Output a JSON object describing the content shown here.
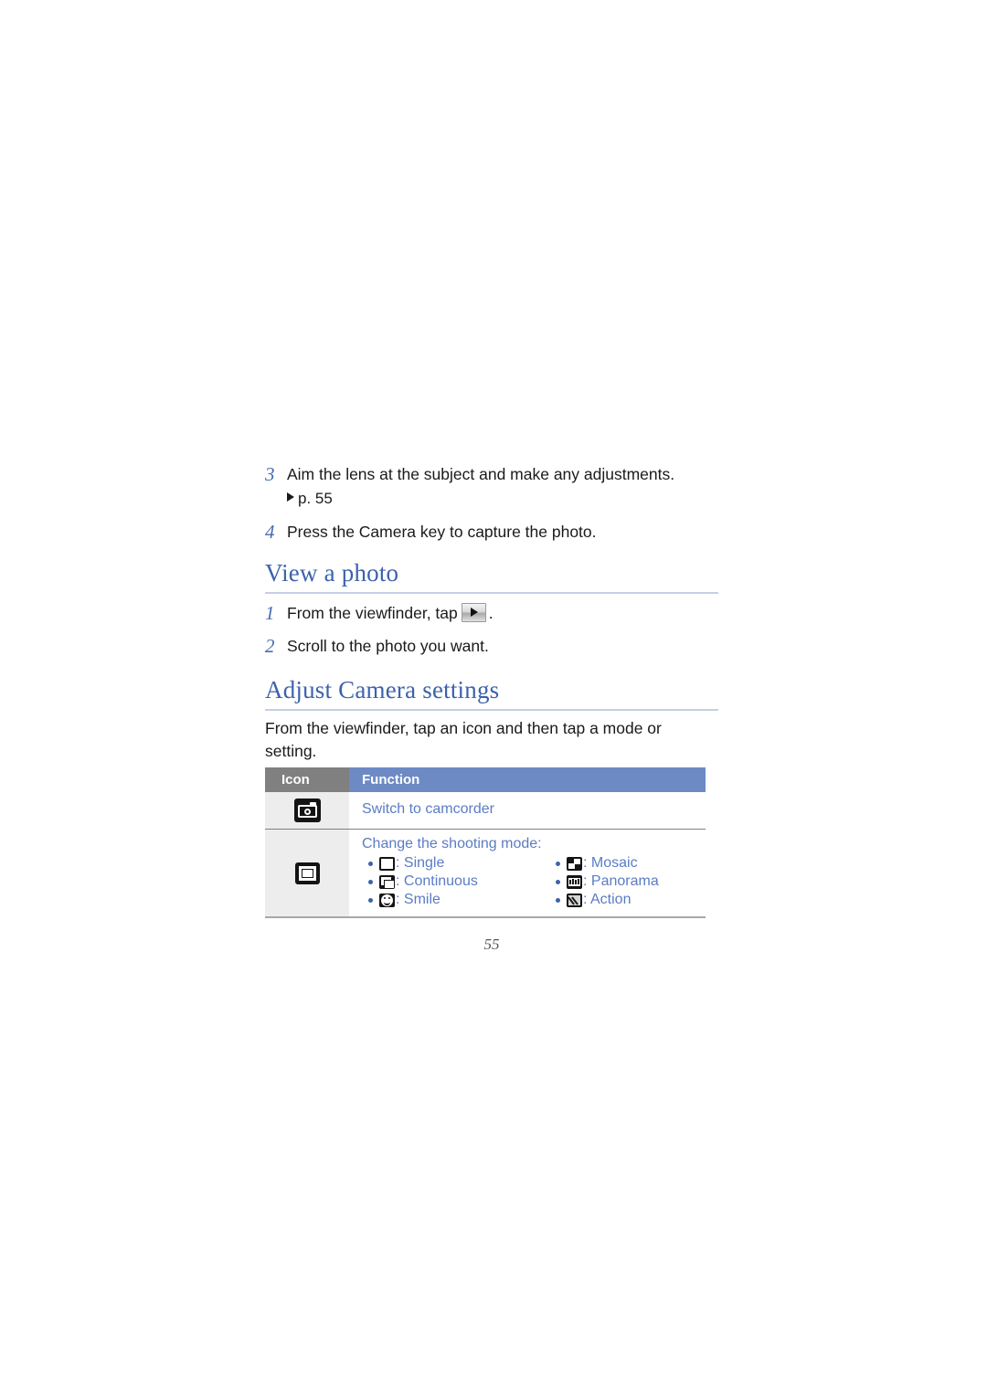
{
  "document": {
    "page_number": "55"
  },
  "steps_top": [
    {
      "num": "3",
      "text": "Aim the lens at the subject and make any adjustments.",
      "reference": "p. 55"
    },
    {
      "num": "4",
      "text": "Press the Camera key to capture the photo.",
      "reference": ""
    }
  ],
  "section_view_photo": {
    "heading": "View a photo",
    "steps": [
      {
        "num": "1",
        "text_before": "From the viewfinder, tap",
        "icon": "play-button-icon",
        "text_after": "."
      },
      {
        "num": "2",
        "text_before": "Scroll to the photo you want.",
        "icon": "",
        "text_after": ""
      }
    ]
  },
  "section_adjust_camera": {
    "heading": "Adjust Camera settings",
    "intro": "From the viewfinder, tap an icon and then tap a mode or setting.",
    "table": {
      "headers": {
        "icon": "Icon",
        "function": "Function"
      },
      "rows": [
        {
          "icon_name": "camera-icon",
          "function": "Switch to camcorder",
          "modes": []
        },
        {
          "icon_name": "shooting-mode-frame-icon",
          "function": "Change the shooting mode:",
          "modes": [
            {
              "icon_name": "single-shot-icon",
              "label": ": Single"
            },
            {
              "icon_name": "mosaic-shot-icon",
              "label": ": Mosaic"
            },
            {
              "icon_name": "continuous-shot-icon",
              "label": ": Continuous"
            },
            {
              "icon_name": "panorama-shot-icon",
              "label": ": Panorama"
            },
            {
              "icon_name": "smile-shot-icon",
              "label": ": Smile"
            },
            {
              "icon_name": "action-shot-icon",
              "label": ": Action"
            }
          ]
        }
      ]
    }
  },
  "colors": {
    "heading_blue": "#3c62ab",
    "table_header_blue": "#6d8ac4",
    "table_header_gray": "#808080",
    "table_text_blue": "#5b7cc4",
    "icon_cell_gray": "#ededed",
    "rule_blue": "#c3cfe6"
  }
}
